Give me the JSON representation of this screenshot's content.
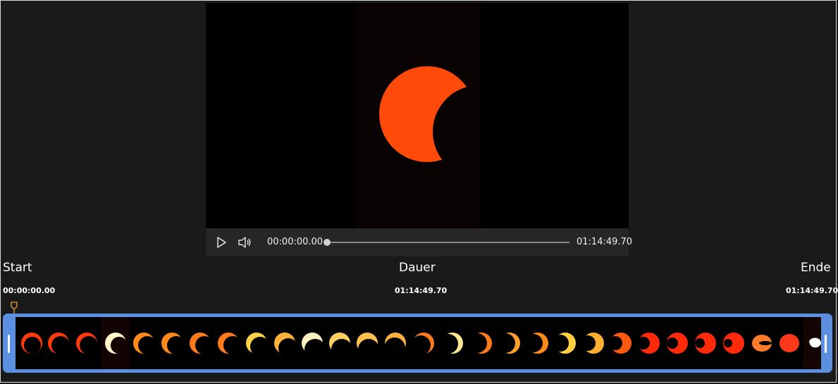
{
  "player": {
    "current_time": "00:00:00.00",
    "total_time": "01:14:49.70",
    "progress": 0.0
  },
  "trim": {
    "start_label": "Start",
    "duration_label": "Dauer",
    "end_label": "Ende",
    "start_time": "00:00:00.00",
    "duration_time": "01:14:49.70",
    "end_time": "01:14:49.70"
  },
  "colors": {
    "accent": "#5b8fe0",
    "playhead": "#e8a23a",
    "sun": "#ff4a0a"
  },
  "icons": {
    "play": "play-icon",
    "volume": "volume-icon",
    "playhead": "playhead-marker-icon"
  }
}
